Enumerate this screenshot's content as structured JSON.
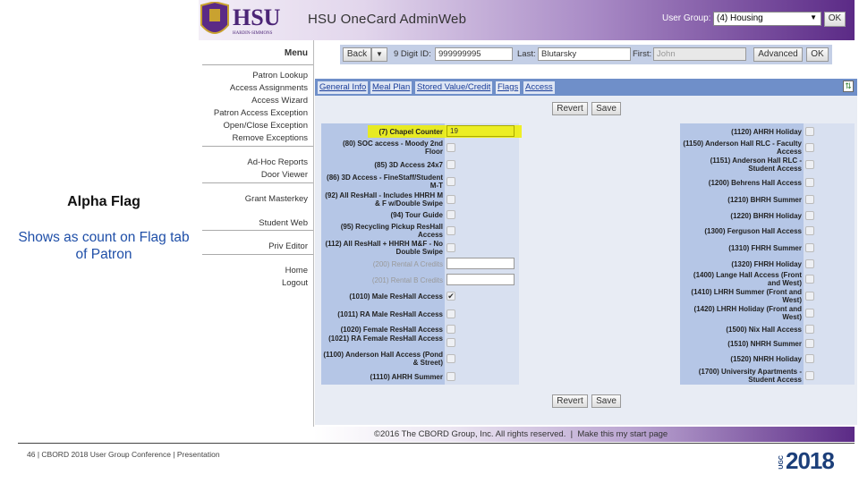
{
  "header": {
    "logo_text": "HSU",
    "logo_sub": "HARDIN-SIMMONS UNIVERSITY",
    "title": "HSU OneCard AdminWeb",
    "user_group_label": "User Group:",
    "user_group_value": "(4) Housing",
    "ok": "OK"
  },
  "menu": {
    "title": "Menu",
    "groups": [
      [
        "Patron Lookup",
        "Access Assignments",
        "Access Wizard",
        "Patron Access Exception",
        "Open/Close Exception",
        "Remove Exceptions"
      ],
      [
        "Ad-Hoc Reports",
        "Door Viewer"
      ],
      [
        "Grant Masterkey",
        "Student Web"
      ],
      [
        "Priv Editor"
      ],
      [
        "Home",
        "Logout"
      ]
    ]
  },
  "search": {
    "back": "Back",
    "id_label": "9 Digit ID:",
    "id_value": "999999995",
    "last_label": "Last:",
    "last_value": "Blutarsky",
    "first_label": "First:",
    "first_value": "John",
    "advanced": "Advanced",
    "ok": "OK"
  },
  "tabs": [
    {
      "label": "General Info"
    },
    {
      "label": "Meal Plan"
    },
    {
      "label": "Stored Value/Credit"
    },
    {
      "label": "Flags",
      "active": true
    },
    {
      "label": "Access"
    }
  ],
  "buttons": {
    "revert": "Revert",
    "save": "Save"
  },
  "flags_left": [
    {
      "label": "(7) Chapel Counter",
      "type": "text",
      "value": "19",
      "highlight": true
    },
    {
      "label": "(80) SOC access - Moody 2nd Floor",
      "type": "checkbox",
      "checked": false
    },
    {
      "label": "(85) 3D Access 24x7",
      "type": "checkbox",
      "checked": false
    },
    {
      "label": "(86) 3D Access - FineStaff/Student M-T",
      "type": "checkbox",
      "checked": false
    },
    {
      "label": "(92) All ResHall - Includes HHRH M & F w/Double Swipe",
      "type": "checkbox",
      "checked": false
    },
    {
      "label": "(94) Tour Guide",
      "type": "checkbox",
      "checked": false
    },
    {
      "label": "(95) Recycling Pickup ResHall Access",
      "type": "checkbox",
      "checked": false
    },
    {
      "label": "(112) All ResHall + HHRH M&F - No Double Swipe",
      "type": "checkbox",
      "checked": false
    },
    {
      "label": "(200) Rental A Credits",
      "type": "text",
      "value": "",
      "disabled": true
    },
    {
      "label": "(201) Rental B Credits",
      "type": "text",
      "value": "",
      "disabled": true
    },
    {
      "label": "(1010) Male ResHall Access",
      "type": "checkbox",
      "checked": true
    },
    {
      "label": "(1011) RA Male ResHall Access",
      "type": "checkbox",
      "checked": false
    },
    {
      "label": "(1020) Female ResHall Access",
      "type": "checkbox",
      "checked": false
    },
    {
      "label": "(1021) RA Female ResHall Access",
      "type": "checkbox",
      "checked": false
    },
    {
      "label": "(1100) Anderson Hall Access (Pond & Street)",
      "type": "checkbox",
      "checked": false
    },
    {
      "label": "(1110) AHRH Summer",
      "type": "checkbox",
      "checked": false
    }
  ],
  "flags_right": [
    {
      "label": "(1120) AHRH Holiday",
      "checked": false
    },
    {
      "label": "(1150) Anderson Hall RLC - Faculty Access",
      "checked": false
    },
    {
      "label": "(1151) Anderson Hall RLC - Student Access",
      "checked": false
    },
    {
      "label": "(1200) Behrens Hall Access",
      "checked": false
    },
    {
      "label": "(1210) BHRH Summer",
      "checked": false
    },
    {
      "label": "(1220) BHRH Holiday",
      "checked": false
    },
    {
      "label": "(1300) Ferguson Hall Access",
      "checked": false
    },
    {
      "label": "(1310) FHRH Summer",
      "checked": false
    },
    {
      "label": "(1320) FHRH Holiday",
      "checked": false
    },
    {
      "label": "(1400) Lange Hall Access (Front and West)",
      "checked": false
    },
    {
      "label": "(1410) LHRH Summer (Front and West)",
      "checked": false
    },
    {
      "label": "(1420) LHRH Holiday (Front and West)",
      "checked": false
    },
    {
      "label": "(1500) Nix Hall Access",
      "checked": false
    },
    {
      "label": "(1510) NHRH Summer",
      "checked": false
    },
    {
      "label": "(1520) NHRH Holiday",
      "checked": false
    },
    {
      "label": "(1700) University Apartments - Student Access",
      "checked": false
    }
  ],
  "footer": {
    "copyright": "©2016 The CBORD Group, Inc. All rights reserved.",
    "separator": "|",
    "start_page": "Make this my start page"
  },
  "slide": {
    "note_title": "Alpha Flag",
    "note_body": "Shows as count on Flag tab of Patron",
    "footer": "46 | CBORD 2018 User Group Conference | Presentation",
    "logo_ugc": "UGC",
    "logo_year": "2018"
  },
  "colors": {
    "purple": "#5b2a86",
    "highlight": "#f0f000",
    "note_blue": "#1f4fa8"
  }
}
